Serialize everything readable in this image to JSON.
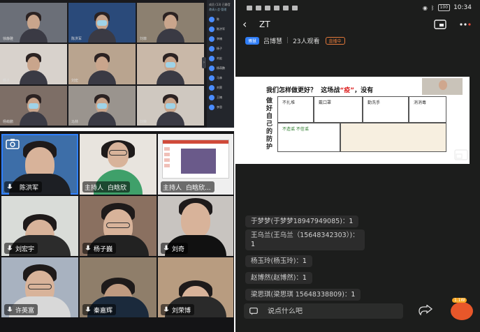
{
  "desktop": {
    "side_header": "成员 (13) 已静音",
    "side_subheader": "邀请入会·管理",
    "participants": [
      "陈",
      "陈洪军",
      "李楠",
      "杨子",
      "刘宏",
      "杨萌鹏",
      "马林",
      "刘荣",
      "王楠",
      "李思"
    ],
    "tiles": [
      "徐静雅",
      "陈洪军",
      "刘菲",
      "杨子",
      "刘宏",
      "",
      "杨萌鹏",
      "马林",
      "刘荣"
    ]
  },
  "phone_grid": {
    "tiles": [
      {
        "name": "陈洪军",
        "host": "",
        "active": true
      },
      {
        "name": "白晗欣",
        "host": "主持人",
        "active": false
      },
      {
        "name": "白晗欣...",
        "host": "主持人",
        "active": false
      },
      {
        "name": "刘宏宇",
        "host": "",
        "active": false
      },
      {
        "name": "杨子巍",
        "host": "",
        "active": false
      },
      {
        "name": "刘奇",
        "host": "",
        "active": false
      },
      {
        "name": "许英富",
        "host": "",
        "active": false
      },
      {
        "name": "秦嘉辉",
        "host": "",
        "active": false
      },
      {
        "name": "刘荣博",
        "host": "",
        "active": false
      }
    ]
  },
  "live": {
    "status": {
      "time": "10:34",
      "battery": "100"
    },
    "title": "ZT",
    "badge": "博慧",
    "host_name": "吕博慧",
    "viewers": "23人观看",
    "live_tag": "直播中",
    "slide": {
      "title_pre": "我们怎样做更好？",
      "title_mid": "这场战",
      "title_red": "“疫”",
      "title_post": "，没有",
      "side_text": "做好自己的防护",
      "cells": [
        "不扎堆",
        "戴口罩",
        "勤洗手",
        "消消毒",
        "不造谣 不信谣",
        ""
      ]
    },
    "messages": [
      {
        "name": "于梦梦(于梦梦18947949085)：",
        "text": "1"
      },
      {
        "name": "王乌兰(王乌兰（15648342303）)：",
        "text": "1"
      },
      {
        "name": "杨玉玲(杨玉玲)：",
        "text": "1"
      },
      {
        "name": "赵博然(赵博然)：",
        "text": "1"
      },
      {
        "name": "梁思琪(梁思琪 15648338809)：",
        "text": "1"
      }
    ],
    "input_placeholder": "说点什么吧",
    "like_count": "1.1W"
  }
}
